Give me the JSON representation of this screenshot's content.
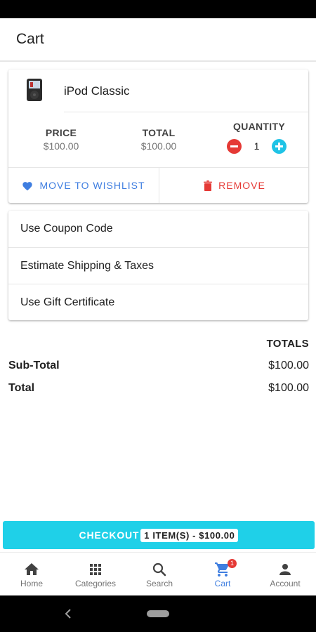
{
  "app_bar": {
    "title": "Cart"
  },
  "cart_item": {
    "name": "iPod Classic",
    "thumbnail_icon": "ipod-classic-image",
    "price_label": "PRICE",
    "price_value": "$100.00",
    "total_label": "TOTAL",
    "total_value": "$100.00",
    "quantity_label": "QUANTITY",
    "quantity_value": "1",
    "minus_icon": "minus-circle-icon",
    "plus_icon": "plus-circle-icon",
    "wishlist_label": "MOVE TO WISHLIST",
    "wishlist_icon": "heart-icon",
    "remove_label": "REMOVE",
    "remove_icon": "trash-icon"
  },
  "options": [
    {
      "label": "Use Coupon Code"
    },
    {
      "label": "Estimate Shipping & Taxes"
    },
    {
      "label": "Use Gift Certificate"
    }
  ],
  "totals": {
    "heading": "TOTALS",
    "subtotal_label": "Sub-Total",
    "subtotal_value": "$100.00",
    "total_label": "Total",
    "total_value": "$100.00"
  },
  "checkout": {
    "label": "CHECKOUT",
    "summary": "1 ITEM(S) - $100.00"
  },
  "bottom_nav": {
    "items": [
      {
        "label": "Home",
        "icon": "home-icon"
      },
      {
        "label": "Categories",
        "icon": "grid-icon"
      },
      {
        "label": "Search",
        "icon": "search-icon"
      },
      {
        "label": "Cart",
        "icon": "cart-icon",
        "badge": "1",
        "active": true
      },
      {
        "label": "Account",
        "icon": "person-icon"
      }
    ]
  },
  "colors": {
    "accent": "#1fd0e8",
    "active_nav": "#3f7ee0",
    "danger": "#e53935",
    "wishlist": "#3f7ee0"
  }
}
